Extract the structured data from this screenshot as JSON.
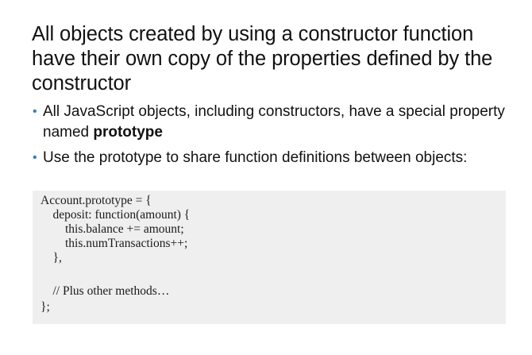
{
  "title": "All objects created by using a constructor function have their own copy of the properties defined by the constructor",
  "bullets": [
    {
      "text_before": "All JavaScript objects, including constructors, have a special property named ",
      "emphasis": "prototype",
      "text_after": ""
    },
    {
      "text_before": "Use the prototype to share function definitions between objects:",
      "emphasis": "",
      "text_after": ""
    }
  ],
  "code": {
    "lines": [
      "Account.prototype = {",
      "    deposit: function(amount) {",
      "        this.balance += amount;",
      "        this.numTransactions++;",
      "    },",
      "",
      "    // Plus other methods…",
      "};"
    ]
  },
  "colors": {
    "bullet_accent": "#2f7fc1",
    "code_background": "#efefef"
  }
}
